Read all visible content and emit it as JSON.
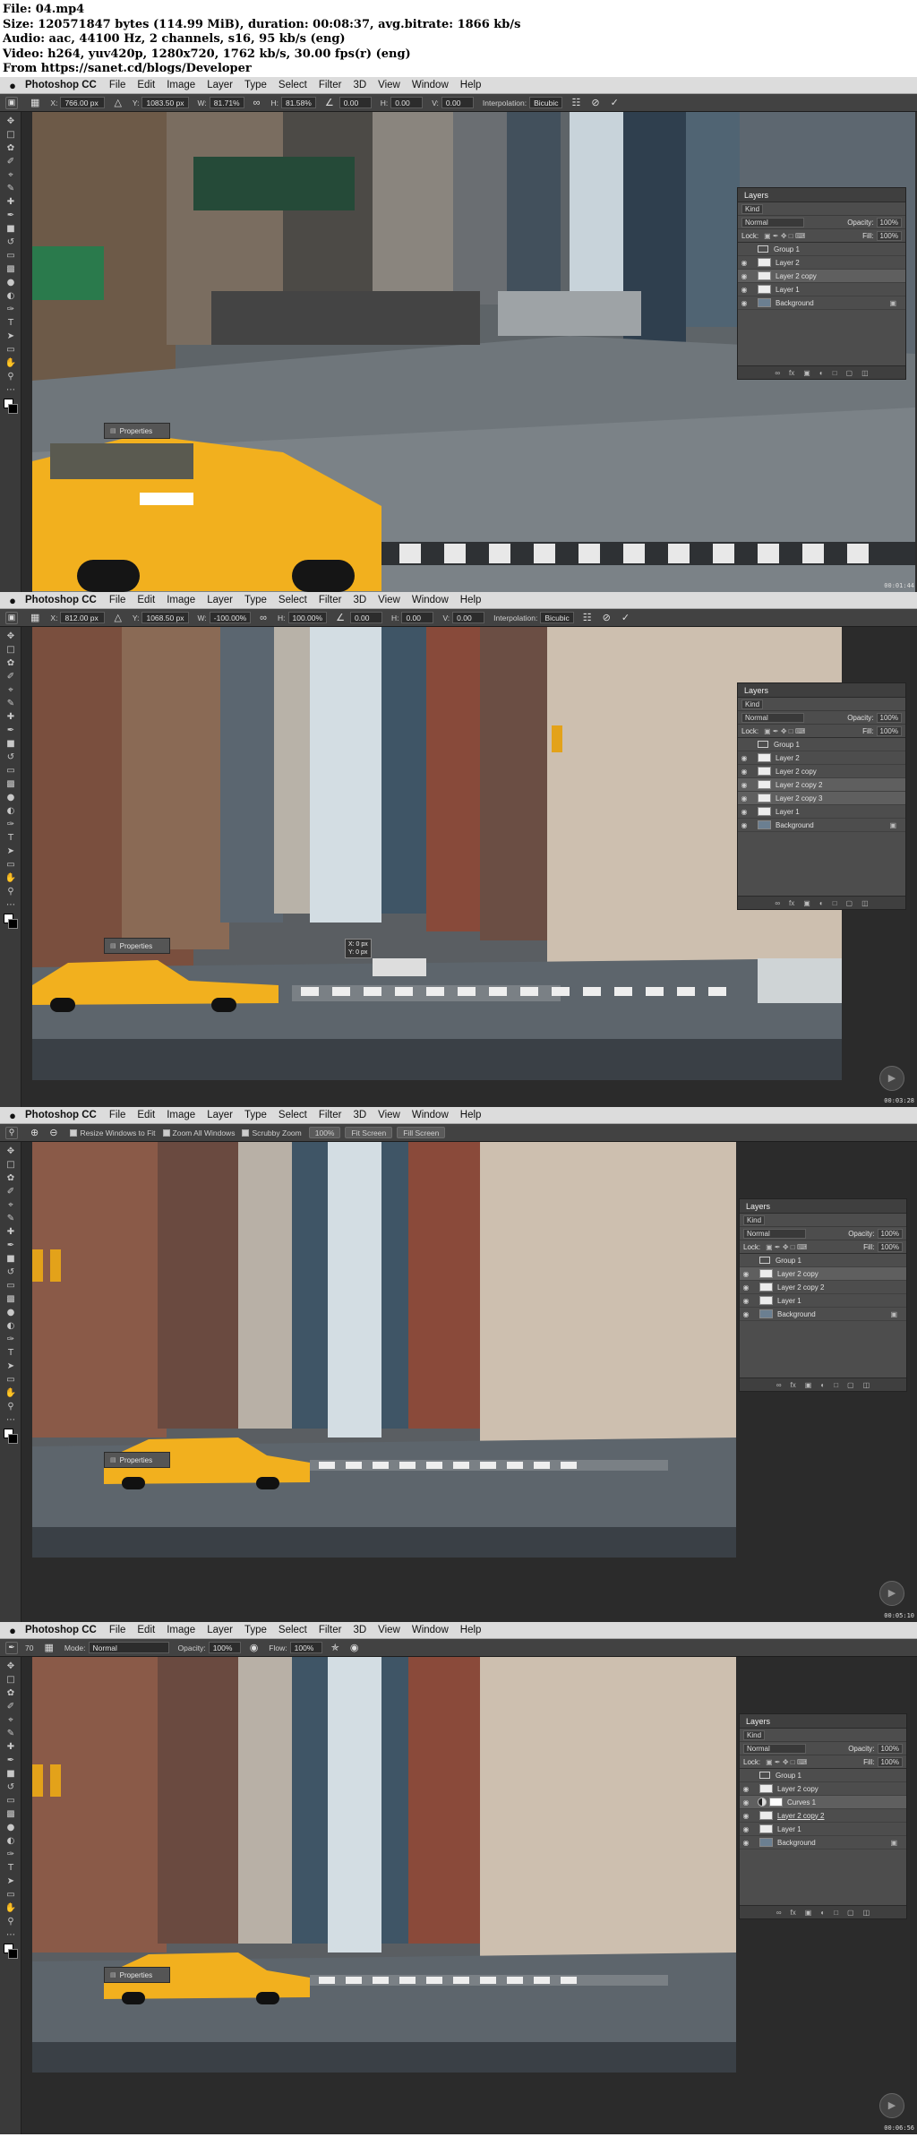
{
  "header": {
    "lines": [
      "File: 04.mp4",
      "Size: 120571847 bytes (114.99 MiB), duration: 00:08:37, avg.bitrate: 1866 kb/s",
      "Audio: aac, 44100 Hz, 2 channels, s16, 95 kb/s (eng)",
      "Video: h264, yuv420p, 1280x720, 1762 kb/s, 30.00 fps(r) (eng)",
      "From https://sanet.cd/blogs/Developer"
    ]
  },
  "menubar": {
    "apple": "",
    "app": "Photoshop CC",
    "items": [
      "File",
      "Edit",
      "Image",
      "Layer",
      "Type",
      "Select",
      "Filter",
      "3D",
      "View",
      "Window",
      "Help"
    ]
  },
  "frames": [
    {
      "timestamp": "00:01:44",
      "options": {
        "x_label": "X:",
        "x": "766.00 px",
        "y_label": "Y:",
        "y": "1083.50 px",
        "w_label": "W:",
        "w": "81.71%",
        "h_label": "H:",
        "h": "81.58%",
        "angle": "0.00",
        "hskew_label": "H:",
        "hskew": "0.00",
        "vskew_label": "V:",
        "vskew": "0.00",
        "interp_label": "Interpolation:",
        "interp": "Bicubic"
      },
      "properties_label": "Properties",
      "layers": {
        "title": "Layers",
        "kind": "Kind",
        "blend": "Normal",
        "opacity_label": "Opacity:",
        "opacity": "100%",
        "lock_label": "Lock:",
        "fill_label": "Fill:",
        "fill": "100%",
        "rows": [
          {
            "name": "Group 1",
            "type": "group",
            "eye": false,
            "selected": false
          },
          {
            "name": "Layer 2",
            "type": "layer",
            "eye": true,
            "selected": false
          },
          {
            "name": "Layer 2 copy",
            "type": "layer",
            "eye": true,
            "selected": true
          },
          {
            "name": "Layer 1",
            "type": "layer",
            "eye": true,
            "selected": false
          },
          {
            "name": "Background",
            "type": "bg",
            "eye": true,
            "selected": false
          }
        ]
      }
    },
    {
      "timestamp": "00:03:28",
      "options": {
        "x_label": "X:",
        "x": "812.00 px",
        "y_label": "Y:",
        "y": "1068.50 px",
        "w_label": "W:",
        "w": "-100.00%",
        "h_label": "H:",
        "h": "100.00%",
        "angle": "0.00",
        "hskew_label": "H:",
        "hskew": "0.00",
        "vskew_label": "V:",
        "vskew": "0.00",
        "interp_label": "Interpolation:",
        "interp": "Bicubic"
      },
      "tooltip": [
        "X: 0 px",
        "Y: 0 px"
      ],
      "properties_label": "Properties",
      "layers": {
        "title": "Layers",
        "kind": "Kind",
        "blend": "Normal",
        "opacity_label": "Opacity:",
        "opacity": "100%",
        "lock_label": "Lock:",
        "fill_label": "Fill:",
        "fill": "100%",
        "rows": [
          {
            "name": "Group 1",
            "type": "group",
            "eye": false,
            "selected": false
          },
          {
            "name": "Layer 2",
            "type": "layer",
            "eye": true,
            "selected": false
          },
          {
            "name": "Layer 2 copy",
            "type": "layer",
            "eye": true,
            "selected": false
          },
          {
            "name": "Layer 2 copy 2",
            "type": "layer",
            "eye": true,
            "selected": true
          },
          {
            "name": "Layer 2 copy 3",
            "type": "layer",
            "eye": true,
            "selected": true
          },
          {
            "name": "Layer 1",
            "type": "layer",
            "eye": true,
            "selected": false
          },
          {
            "name": "Background",
            "type": "bg",
            "eye": true,
            "selected": false
          }
        ]
      }
    },
    {
      "timestamp": "00:05:10",
      "zoom_options": {
        "resize_label": "Resize Windows to Fit",
        "zoom_all_label": "Zoom All Windows",
        "scrubby_label": "Scrubby Zoom",
        "pct": "100%",
        "fit_label": "Fit Screen",
        "fill_label": "Fill Screen"
      },
      "properties_label": "Properties",
      "layers": {
        "title": "Layers",
        "kind": "Kind",
        "blend": "Normal",
        "opacity_label": "Opacity:",
        "opacity": "100%",
        "lock_label": "Lock:",
        "fill_label": "Fill:",
        "fill": "100%",
        "rows": [
          {
            "name": "Group 1",
            "type": "group",
            "eye": false,
            "selected": false
          },
          {
            "name": "Layer 2 copy",
            "type": "layer",
            "eye": true,
            "selected": true
          },
          {
            "name": "Layer 2 copy 2",
            "type": "layer",
            "eye": true,
            "selected": false
          },
          {
            "name": "Layer 1",
            "type": "layer",
            "eye": true,
            "selected": false
          },
          {
            "name": "Background",
            "type": "bg",
            "eye": true,
            "selected": false
          }
        ]
      }
    },
    {
      "timestamp": "00:06:56",
      "brush_options": {
        "size": "70",
        "mode_label": "Mode:",
        "mode": "Normal",
        "opacity_label": "Opacity:",
        "opacity": "100%",
        "flow_label": "Flow:",
        "flow": "100%"
      },
      "properties_label": "Properties",
      "layers": {
        "title": "Layers",
        "kind": "Kind",
        "blend": "Normal",
        "opacity_label": "Opacity:",
        "opacity": "100%",
        "lock_label": "Lock:",
        "fill_label": "Fill:",
        "fill": "100%",
        "rows": [
          {
            "name": "Group 1",
            "type": "group",
            "eye": false,
            "selected": false
          },
          {
            "name": "Layer 2 copy",
            "type": "layer",
            "eye": true,
            "selected": false
          },
          {
            "name": "Curves 1",
            "type": "curves",
            "eye": true,
            "selected": true
          },
          {
            "name": "Layer 2 copy 2",
            "type": "layer",
            "eye": true,
            "selected": false
          },
          {
            "name": "Layer 1",
            "type": "layer",
            "eye": true,
            "selected": false
          },
          {
            "name": "Background",
            "type": "bg",
            "eye": true,
            "selected": false
          }
        ]
      }
    }
  ],
  "icons": {
    "eye": "eye-icon",
    "lock": "lock-icon",
    "folder": "folder-icon",
    "confirm": "checkmark-icon",
    "cancel": "cancel-icon",
    "play": "play-icon"
  },
  "colors": {
    "taxi": "#f2b01e",
    "sky": "#cfd9df",
    "ui_dark": "#2b2b2b",
    "panel": "#4d4d4d"
  }
}
